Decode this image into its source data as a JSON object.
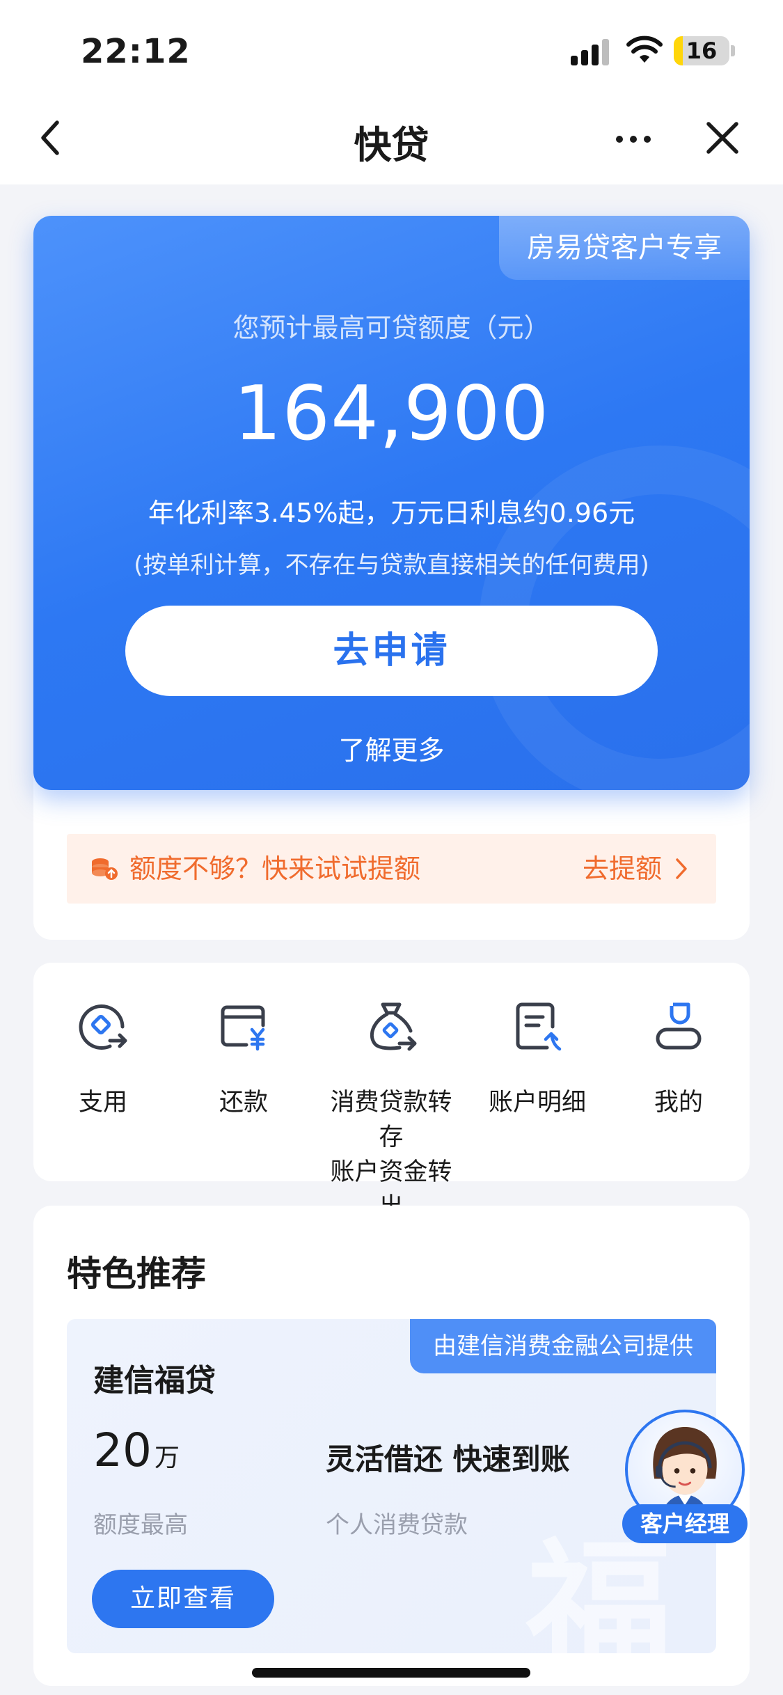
{
  "status_bar": {
    "time": "22:12",
    "battery": "16",
    "battery_level": 0.16
  },
  "nav": {
    "title": "快贷",
    "back_icon": "chevron-left-icon",
    "more_icon": "more-horizontal-icon",
    "close_icon": "close-icon"
  },
  "hero": {
    "badge": "房易贷客户专享",
    "label": "您预计最高可贷额度（元）",
    "amount": "164,900",
    "rate": "年化利率3.45%起，万元日利息约0.96元",
    "note": "(按单利计算，不存在与贷款直接相关的任何费用)",
    "apply_label": "去申请",
    "learn_more": "了解更多",
    "colors": {
      "primary": "#2d76f0",
      "gradient_start": "#4d92fb"
    }
  },
  "tip": {
    "icon": "coin-stack-icon",
    "text": "额度不够？快来试试提额",
    "link": "去提额",
    "link_icon": "chevron-right-icon",
    "color": "#f06b2d"
  },
  "services": [
    {
      "label": "支用",
      "icon": "withdraw-icon"
    },
    {
      "label": "还款",
      "icon": "repay-icon"
    },
    {
      "label": "消费贷款转存账户资金转出",
      "icon": "transfer-bag-icon"
    },
    {
      "label": "账户明细",
      "icon": "account-detail-icon"
    },
    {
      "label": "我的",
      "icon": "user-icon"
    }
  ],
  "recommend": {
    "title": "特色推荐",
    "product": {
      "tag": "由建信消费金融公司提供",
      "name": "建信福贷",
      "amount": "20",
      "unit": "万",
      "amount_label": "额度最高",
      "feature": "灵活借还 快速到账",
      "type": "个人消费贷款",
      "button": "立即查看"
    }
  },
  "manager": {
    "label": "客户经理",
    "icon": "service-agent-avatar-icon"
  }
}
